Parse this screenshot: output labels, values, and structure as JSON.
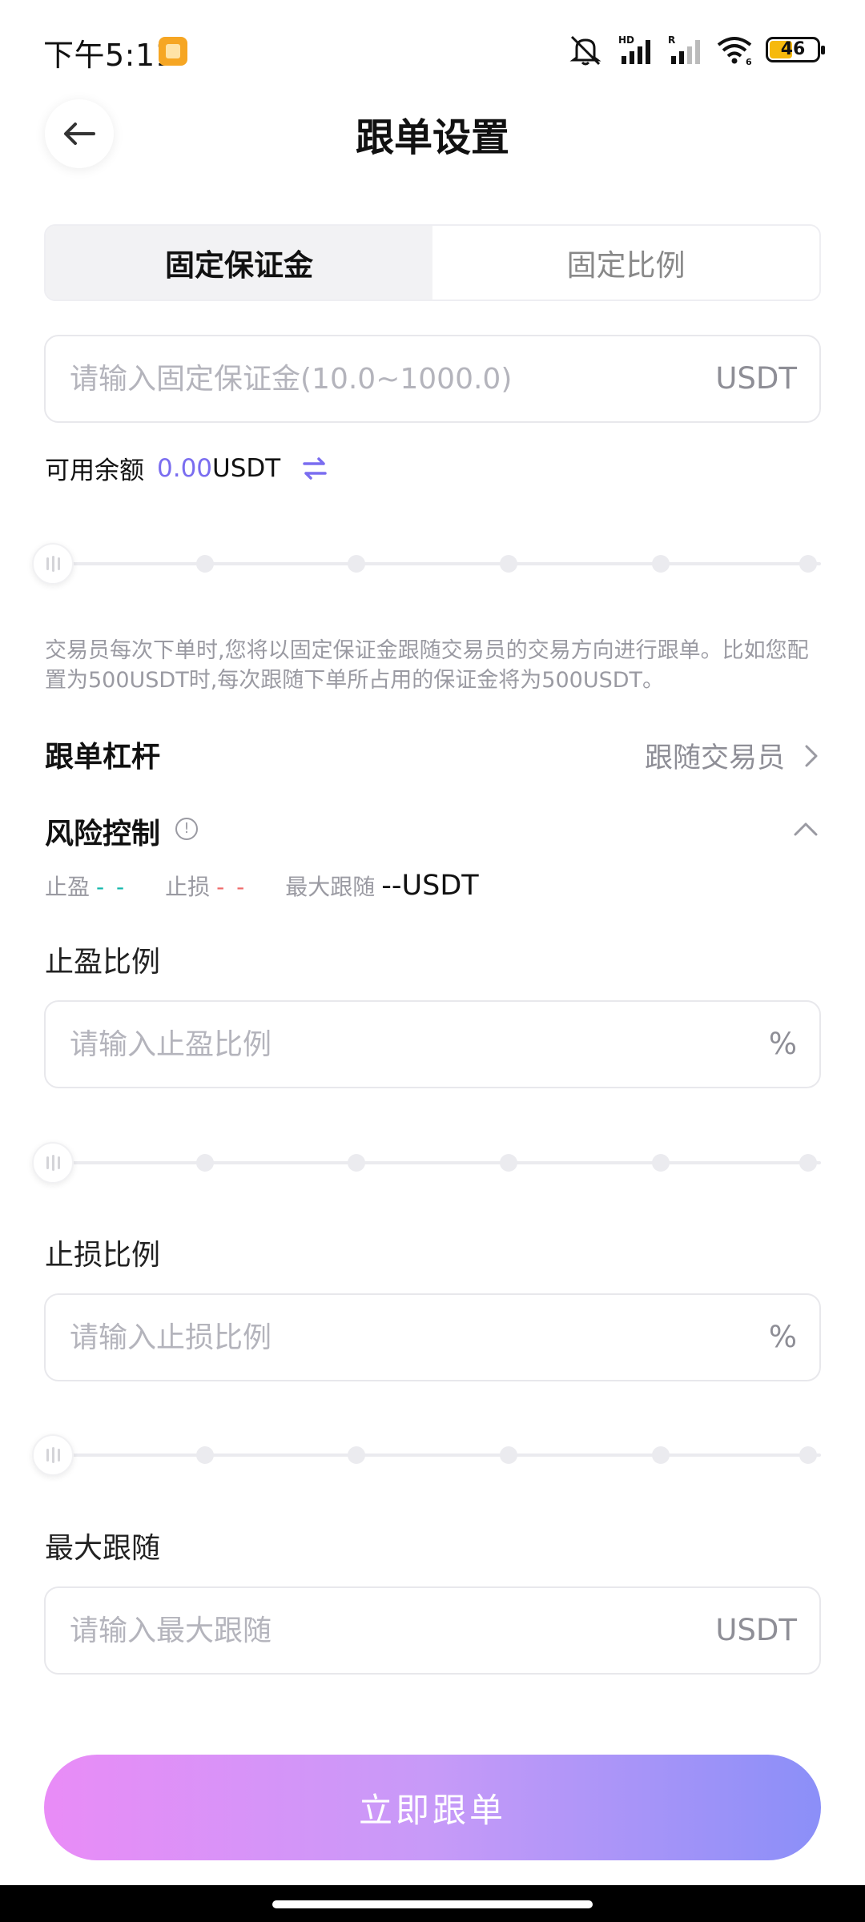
{
  "status_bar": {
    "time": "下午5:11",
    "hd_label": "HD",
    "r_label": "R",
    "wifi_label": "6",
    "battery_level": "46"
  },
  "header": {
    "title": "跟单设置"
  },
  "mode_tabs": [
    {
      "label": "固定保证金",
      "active": true
    },
    {
      "label": "固定比例",
      "active": false
    }
  ],
  "margin_input": {
    "placeholder": "请输入固定保证金(10.0~1000.0)",
    "value": "",
    "suffix": "USDT"
  },
  "balance": {
    "label": "可用余额",
    "amount": "0.00",
    "unit": "USDT"
  },
  "margin_slider": {
    "value": 0,
    "ticks": 6
  },
  "description": "交易员每次下单时,您将以固定保证金跟随交易员的交易方向进行跟单。比如您配置为500USDT时,每次跟随下单所占用的保证金将为500USDT。",
  "leverage": {
    "label": "跟单杠杆",
    "value": "跟随交易员"
  },
  "risk_control": {
    "label": "风险控制",
    "info_icon": "!",
    "take_profit_label": "止盈",
    "take_profit_value": "- -",
    "stop_loss_label": "止损",
    "stop_loss_value": "- -",
    "max_follow_label": "最大跟随",
    "max_follow_value": "--USDT"
  },
  "take_profit": {
    "label": "止盈比例",
    "placeholder": "请输入止盈比例",
    "suffix": "%",
    "slider_value": 0
  },
  "stop_loss": {
    "label": "止损比例",
    "placeholder": "请输入止损比例",
    "suffix": "%",
    "slider_value": 0
  },
  "max_follow": {
    "label": "最大跟随",
    "placeholder": "请输入最大跟随",
    "suffix": "USDT"
  },
  "submit": {
    "label": "立即跟单"
  },
  "colors": {
    "accent": "#7a6df0",
    "take_profit": "#12b7ab",
    "stop_loss": "#ef6a6a",
    "button_gradient": [
      "#e98cf7",
      "#8b8ff8"
    ]
  }
}
